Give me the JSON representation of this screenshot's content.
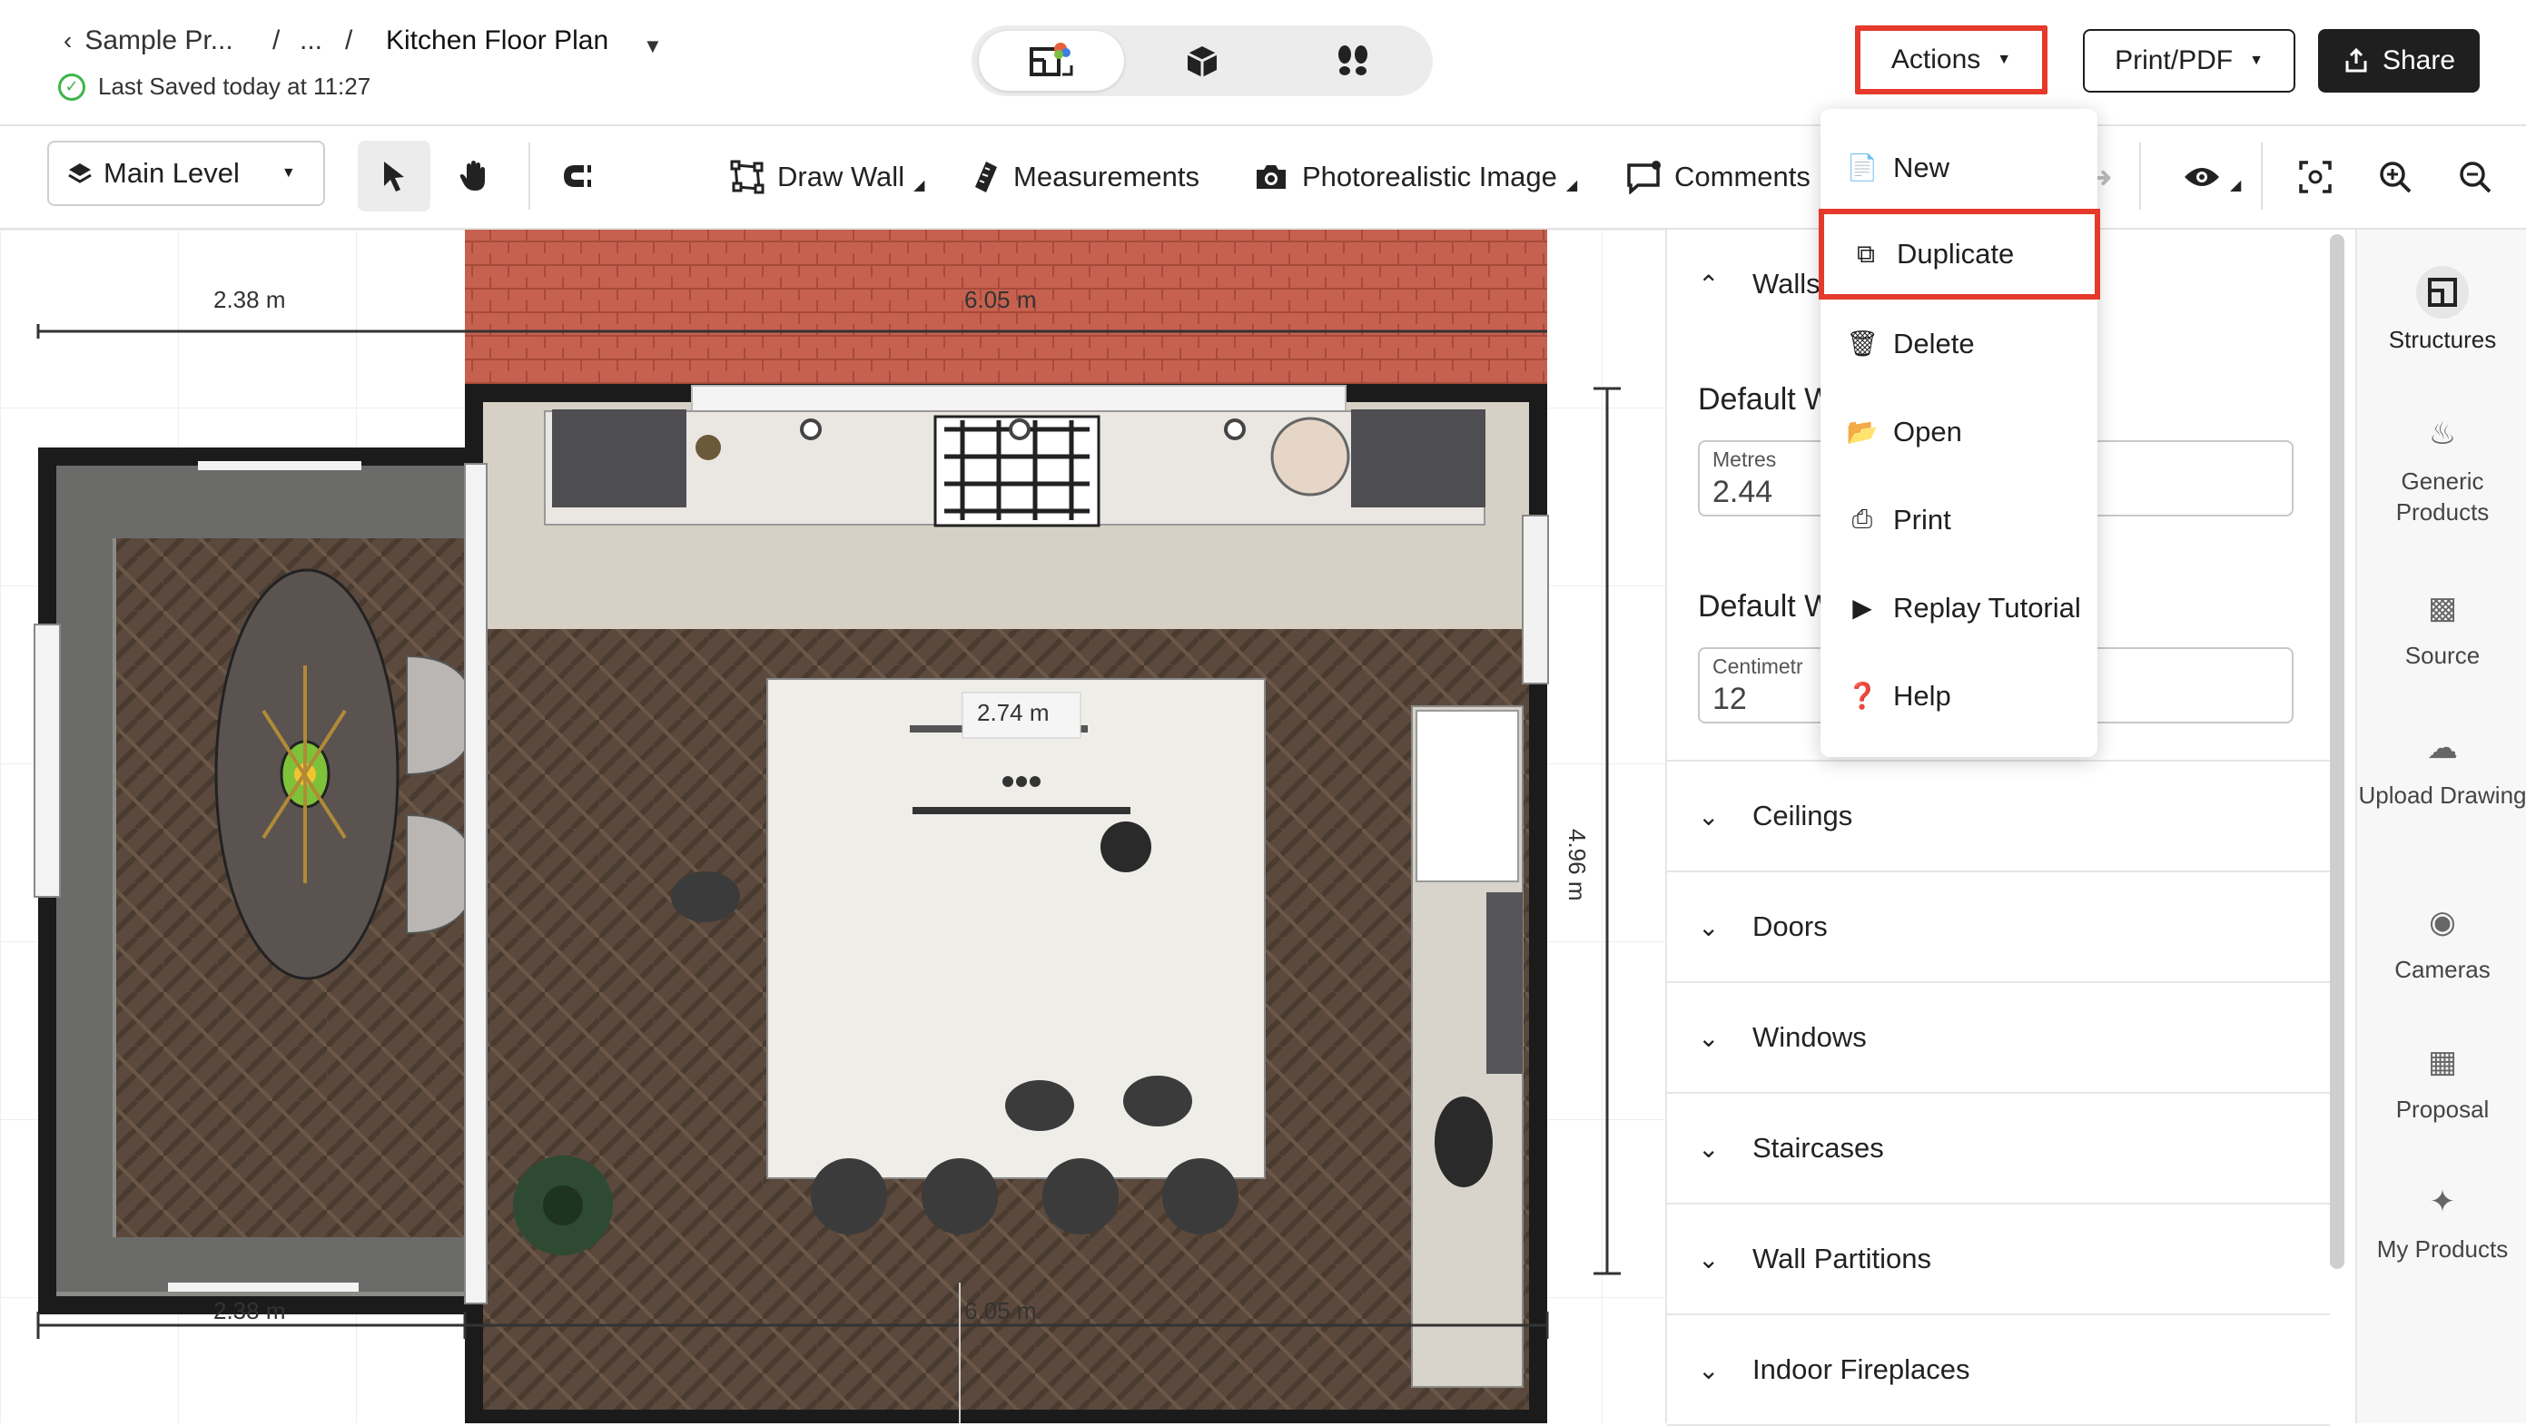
{
  "breadcrumb": {
    "back": "Sample Pr...",
    "ellipsis": "...",
    "sep": "/",
    "current": "Kitchen Floor Plan"
  },
  "saved_status": "Last Saved today at 11:27",
  "header": {
    "actions": "Actions",
    "print": "Print/PDF",
    "share": "Share"
  },
  "toolbar": {
    "level": "Main Level",
    "draw_wall": "Draw Wall",
    "measurements": "Measurements",
    "photo": "Photorealistic Image",
    "comments": "Comments"
  },
  "actions_menu": [
    {
      "label": "New",
      "icon": "file-icon"
    },
    {
      "label": "Duplicate",
      "icon": "duplicate-icon"
    },
    {
      "label": "Delete",
      "icon": "trash-icon"
    },
    {
      "label": "Open",
      "icon": "folder-open-icon"
    },
    {
      "label": "Print",
      "icon": "printer-icon"
    },
    {
      "label": "Replay Tutorial",
      "icon": "play-circle-icon"
    },
    {
      "label": "Help",
      "icon": "help-circle-icon"
    }
  ],
  "panel": {
    "walls": "Walls",
    "default_height": "Default W",
    "height_caption": "Metres",
    "height_value": "2.44",
    "default_thickness": "Default W",
    "thickness_caption": "Centimetr",
    "thickness_value": "12",
    "sections": [
      "Ceilings",
      "Doors",
      "Windows",
      "Staircases",
      "Wall Partitions",
      "Indoor Fireplaces"
    ]
  },
  "rightbar": [
    {
      "label": "Structures",
      "icon": "structures-icon"
    },
    {
      "label": "Generic Products",
      "icon": "generic-products-icon"
    },
    {
      "label": "Source",
      "icon": "source-icon"
    },
    {
      "label": "Upload Drawing",
      "icon": "upload-icon"
    },
    {
      "label": "Cameras",
      "icon": "camera-icon"
    },
    {
      "label": "Proposal",
      "icon": "calculator-icon"
    },
    {
      "label": "My Products",
      "icon": "my-products-icon"
    }
  ],
  "dimensions": {
    "top_left": "2.38 m",
    "top_right": "6.05 m",
    "bottom_left": "2.38 m",
    "bottom_right": "6.05 m",
    "vertical": "4.96 m",
    "island": "2.74 m"
  },
  "colors": {
    "highlight": "#e5392b",
    "share_bg": "#1f1f1f",
    "wall": "#1b1b1b",
    "floor": "#5b4a3d",
    "brick": "#c4604f"
  }
}
